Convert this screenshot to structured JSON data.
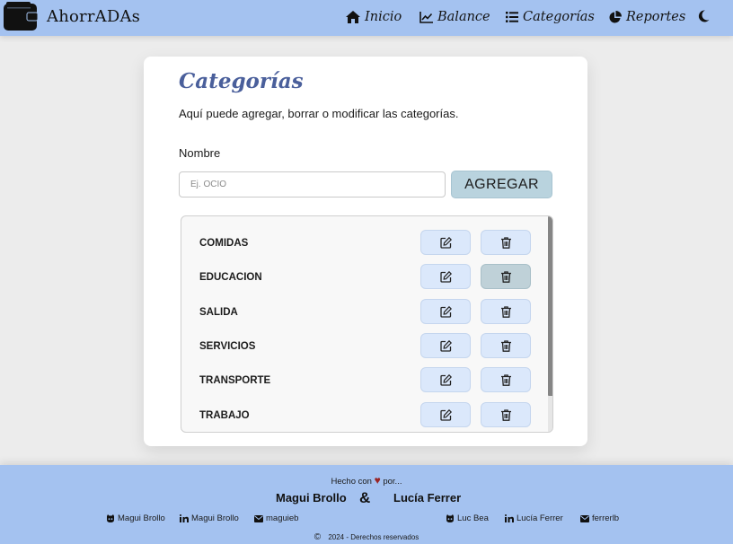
{
  "brand": {
    "name": "AhorrADAs",
    "icon": "wallet-icon"
  },
  "nav": {
    "inicio": "Inicio",
    "balance": "Balance",
    "categorias": "Categorías",
    "reportes": "Reportes",
    "theme_icon": "moon-icon"
  },
  "page": {
    "title": "Categorías",
    "subtitle": "Aquí puede agregar, borrar o modificar las categorías.",
    "field_label": "Nombre",
    "input_placeholder": "Ej. OCIO",
    "input_value": "",
    "add_button": "AGREGAR"
  },
  "categories": [
    {
      "name": "COMIDAS"
    },
    {
      "name": "EDUCACION"
    },
    {
      "name": "SALIDA"
    },
    {
      "name": "SERVICIOS"
    },
    {
      "name": "TRANSPORTE"
    },
    {
      "name": "TRABAJO"
    }
  ],
  "footer": {
    "made_with_prefix": "Hecho con",
    "made_with_suffix": "por...",
    "author1": "Magui Brollo",
    "ampersand": "&",
    "author2": "Lucía Ferrer",
    "social": {
      "a1_github": "Magui Brollo",
      "a1_linkedin": "Magui Brollo",
      "a1_email": "maguieb",
      "a2_github": "Luc Bea",
      "a2_linkedin": "Lucía Ferrer",
      "a2_email": "ferrerlb"
    },
    "copyright_symbol": "©",
    "copyright": "2024 - Derechos reservados"
  },
  "colors": {
    "nav_bg": "#a4c2f0",
    "title": "#4a5f9b",
    "button": "#b9d3de",
    "icon_button": "#dbe8fb"
  }
}
